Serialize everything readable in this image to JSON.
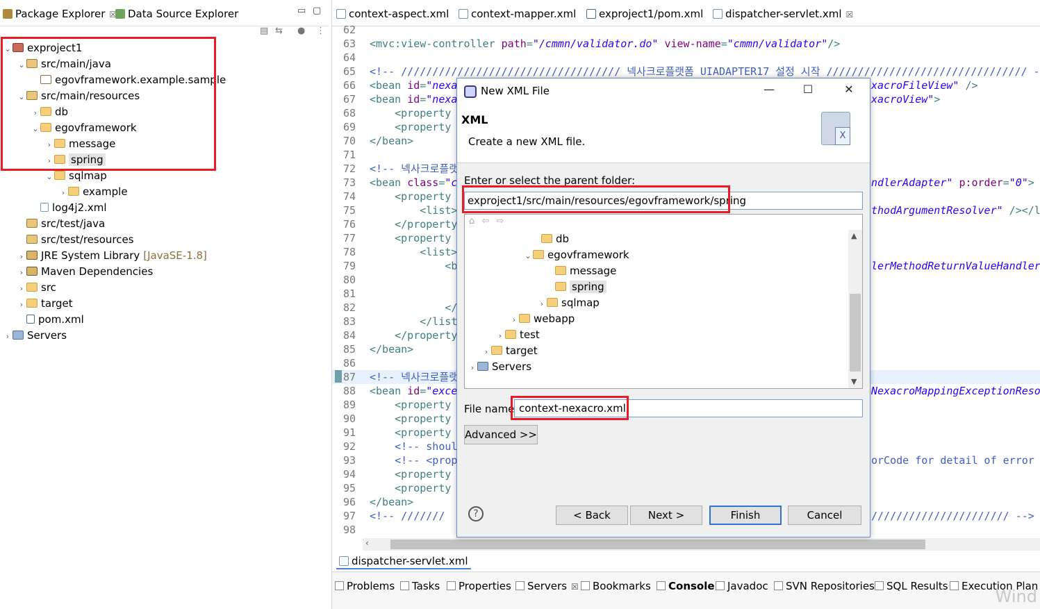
{
  "left_panel": {
    "tabs": [
      {
        "label": "Package Explorer",
        "close": "☒"
      },
      {
        "label": "Data Source Explorer"
      }
    ],
    "window_controls": {
      "minimize": "▭",
      "maximize": "▢"
    },
    "toolbar_icons": [
      "collapse-all-icon",
      "link-with-editor-icon",
      "focus-icon",
      "view-menu-icon"
    ],
    "tree": [
      {
        "label": "exproject1",
        "arrow": "⌄",
        "icon": "project"
      },
      {
        "label": "src/main/java",
        "arrow": "⌄",
        "icon": "srcfolder"
      },
      {
        "label": "egovframework.example.sample",
        "arrow": "",
        "icon": "package"
      },
      {
        "label": "src/main/resources",
        "arrow": "⌄",
        "icon": "srcfolder"
      },
      {
        "label": "db",
        "arrow": "›",
        "icon": "folder"
      },
      {
        "label": "egovframework",
        "arrow": "⌄",
        "icon": "folder"
      },
      {
        "label": "message",
        "arrow": "›",
        "icon": "folder"
      },
      {
        "label": "spring",
        "arrow": "›",
        "icon": "folder",
        "selected": true
      },
      {
        "label": "sqlmap",
        "arrow": "⌄",
        "icon": "folder"
      },
      {
        "label": "example",
        "arrow": "›",
        "icon": "folder"
      },
      {
        "label": "log4j2.xml",
        "arrow": "",
        "icon": "xml"
      },
      {
        "label": "src/test/java",
        "arrow": "",
        "icon": "srcfolder"
      },
      {
        "label": "src/test/resources",
        "arrow": "",
        "icon": "srcfolder"
      },
      {
        "label": "JRE System Library",
        "suffix": "[JavaSE-1.8]",
        "arrow": "›",
        "icon": "library"
      },
      {
        "label": "Maven Dependencies",
        "arrow": "›",
        "icon": "library"
      },
      {
        "label": "src",
        "arrow": "›",
        "icon": "folder"
      },
      {
        "label": "target",
        "arrow": "›",
        "icon": "folder"
      },
      {
        "label": "pom.xml",
        "arrow": "",
        "icon": "maven-xml"
      },
      {
        "label": "Servers",
        "arrow": "›",
        "icon": "servers"
      }
    ]
  },
  "editor": {
    "tabs": [
      {
        "label": "context-aspect.xml"
      },
      {
        "label": "context-mapper.xml"
      },
      {
        "label": "exproject1/pom.xml"
      },
      {
        "label": "dispatcher-servlet.xml",
        "close": "☒"
      }
    ],
    "lines": [
      {
        "n": "62",
        "parts": []
      },
      {
        "n": "63",
        "parts": [
          [
            "tag",
            "<mvc:view-controller "
          ],
          [
            "attr",
            "path"
          ],
          [
            "tag",
            "="
          ],
          [
            "val",
            "\"/cmmn/validator.do\""
          ],
          [
            "tag",
            " "
          ],
          [
            "attr",
            "view-name"
          ],
          [
            "tag",
            "="
          ],
          [
            "val",
            "\"cmmn/validator\""
          ],
          [
            "tag",
            "/>"
          ]
        ]
      },
      {
        "n": "64",
        "parts": []
      },
      {
        "n": "65",
        "parts": [
          [
            "cmt",
            "<!-- /////////////////////////////////// 넥사크로플랫폼 UIADAPTER17 설정 시작 //////////////////////////////// --:"
          ]
        ]
      },
      {
        "n": "66",
        "parts": [
          [
            "tag",
            "<bean "
          ],
          [
            "attr",
            "id"
          ],
          [
            "tag",
            "="
          ],
          [
            "val",
            "\"nexa"
          ]
        ]
      },
      {
        "n": "67",
        "parts": [
          [
            "tag",
            "<bean "
          ],
          [
            "attr",
            "id"
          ],
          [
            "tag",
            "="
          ],
          [
            "val",
            "\"nexa"
          ]
        ]
      },
      {
        "n": "68",
        "parts": [
          [
            "tag",
            "    <property"
          ]
        ]
      },
      {
        "n": "69",
        "parts": [
          [
            "tag",
            "    <property"
          ]
        ]
      },
      {
        "n": "70",
        "parts": [
          [
            "tag",
            "</bean>"
          ]
        ]
      },
      {
        "n": "71",
        "parts": []
      },
      {
        "n": "72",
        "parts": [
          [
            "cmt",
            "<!-- 넥사크로플랫폼"
          ]
        ]
      },
      {
        "n": "73",
        "parts": [
          [
            "tag",
            "<bean "
          ],
          [
            "attr",
            "class"
          ],
          [
            "tag",
            "="
          ],
          [
            "val",
            "\"c"
          ]
        ]
      },
      {
        "n": "74",
        "parts": [
          [
            "tag",
            "    <property"
          ]
        ]
      },
      {
        "n": "75",
        "parts": [
          [
            "tag",
            "        <list>"
          ]
        ]
      },
      {
        "n": "76",
        "parts": [
          [
            "tag",
            "    </property"
          ]
        ]
      },
      {
        "n": "77",
        "parts": [
          [
            "tag",
            "    <property"
          ]
        ]
      },
      {
        "n": "78",
        "parts": [
          [
            "tag",
            "        <list>"
          ]
        ]
      },
      {
        "n": "79",
        "parts": [
          [
            "tag",
            "            <b"
          ]
        ]
      },
      {
        "n": "80",
        "parts": []
      },
      {
        "n": "81",
        "parts": []
      },
      {
        "n": "82",
        "parts": [
          [
            "tag",
            "            </"
          ]
        ]
      },
      {
        "n": "83",
        "parts": [
          [
            "tag",
            "        </list"
          ]
        ]
      },
      {
        "n": "84",
        "parts": [
          [
            "tag",
            "    </property"
          ]
        ]
      },
      {
        "n": "85",
        "parts": [
          [
            "tag",
            "</bean>"
          ]
        ]
      },
      {
        "n": "86",
        "parts": []
      },
      {
        "n": "87",
        "parts": [
          [
            "cmt",
            "<!-- 넥사크로플랫폼"
          ]
        ]
      },
      {
        "n": "88",
        "parts": [
          [
            "tag",
            "<bean "
          ],
          [
            "attr",
            "id"
          ],
          [
            "tag",
            "="
          ],
          [
            "val",
            "\"exce"
          ]
        ]
      },
      {
        "n": "89",
        "parts": [
          [
            "tag",
            "    <property"
          ]
        ]
      },
      {
        "n": "90",
        "parts": [
          [
            "tag",
            "    <property"
          ]
        ]
      },
      {
        "n": "91",
        "parts": [
          [
            "tag",
            "    <property"
          ]
        ]
      },
      {
        "n": "92",
        "parts": [
          [
            "cmt",
            "    <!-- shoul"
          ]
        ]
      },
      {
        "n": "93",
        "parts": [
          [
            "cmt",
            "    <!-- <prop"
          ]
        ]
      },
      {
        "n": "94",
        "parts": [
          [
            "tag",
            "    <property"
          ]
        ]
      },
      {
        "n": "95",
        "parts": [
          [
            "tag",
            "    <property"
          ]
        ]
      },
      {
        "n": "96",
        "parts": [
          [
            "tag",
            "</bean>"
          ]
        ]
      },
      {
        "n": "97",
        "parts": [
          [
            "cmt",
            "<!-- ///////"
          ]
        ]
      },
      {
        "n": "98",
        "parts": []
      }
    ],
    "right_fragments": [
      {
        "line": "66",
        "parts": [
          [
            "val",
            "xacroFileView\""
          ],
          [
            "tag",
            " />"
          ]
        ]
      },
      {
        "line": "67",
        "parts": [
          [
            "val",
            "xacroView\""
          ],
          [
            "tag",
            ">"
          ]
        ]
      },
      {
        "line": "73",
        "parts": [
          [
            "val",
            "ndlerAdapter\""
          ],
          [
            "tag",
            " "
          ],
          [
            "attr",
            "p:order"
          ],
          [
            "tag",
            "="
          ],
          [
            "val",
            "\"0\""
          ],
          [
            "tag",
            ">"
          ]
        ]
      },
      {
        "line": "75",
        "parts": [
          [
            "val",
            "thodArgumentResolver\""
          ],
          [
            "tag",
            " /></l"
          ]
        ]
      },
      {
        "line": "79",
        "parts": [
          [
            "val",
            "lerMethodReturnValueHandler"
          ]
        ]
      },
      {
        "line": "88",
        "parts": [
          [
            "val",
            "NexacroMappingExceptionReso"
          ]
        ]
      },
      {
        "line": "93",
        "parts": [
          [
            "cmt",
            "orCode for detail of error :"
          ]
        ]
      },
      {
        "line": "97",
        "parts": [
          [
            "cmt",
            "////////////////////// -->"
          ]
        ]
      }
    ],
    "bottom_tab": "dispatcher-servlet.xml"
  },
  "bottom_views": [
    {
      "label": "Problems"
    },
    {
      "label": "Tasks"
    },
    {
      "label": "Properties"
    },
    {
      "label": "Servers",
      "close": "☒"
    },
    {
      "label": "Bookmarks"
    },
    {
      "label": "Console",
      "bold": true
    },
    {
      "label": "Javadoc"
    },
    {
      "label": "SVN Repositories"
    },
    {
      "label": "SQL Results"
    },
    {
      "label": "Execution Plan"
    }
  ],
  "watermark": "Wind",
  "dialog": {
    "title": "New XML File",
    "window_buttons": {
      "minimize": "—",
      "maximize": "☐",
      "close": "✕"
    },
    "header_title": "XML",
    "header_desc": "Create a new XML file.",
    "wizard_image_glyph": "X",
    "parent_label": "Enter or select the parent folder:",
    "parent_value": "exproject1/src/main/resources/egovframework/spring",
    "tree_nav": [
      "home-icon",
      "back-icon",
      "forward-icon"
    ],
    "tree": [
      {
        "label": "db",
        "arrow": ""
      },
      {
        "label": "egovframework",
        "arrow": "⌄"
      },
      {
        "label": "message",
        "arrow": ""
      },
      {
        "label": "spring",
        "arrow": "",
        "selected": true
      },
      {
        "label": "sqlmap",
        "arrow": "›"
      },
      {
        "label": "webapp",
        "arrow": "›"
      },
      {
        "label": "test",
        "arrow": "›"
      },
      {
        "label": "target",
        "arrow": "›"
      },
      {
        "label": "Servers",
        "arrow": "›"
      }
    ],
    "scroll_up": "▲",
    "scroll_down": "▼",
    "file_name_label": "File name:",
    "file_name_value": "context-nexacro.xml",
    "advanced_label": "Advanced >>",
    "help": "?",
    "buttons": {
      "back": "< Back",
      "next": "Next >",
      "finish": "Finish",
      "cancel": "Cancel"
    }
  }
}
